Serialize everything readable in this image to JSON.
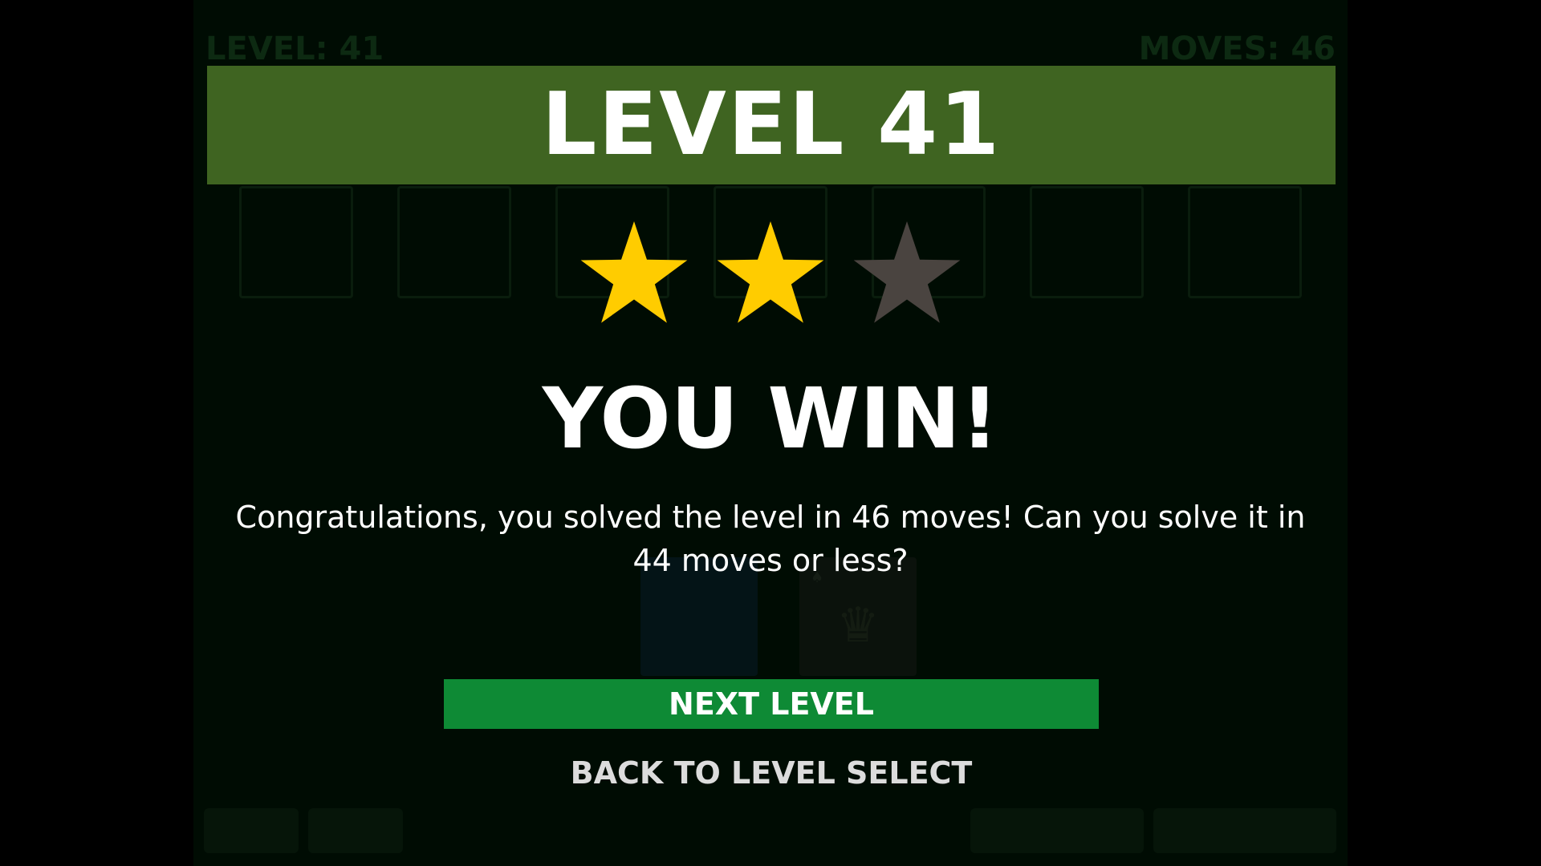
{
  "background": {
    "level_label": "LEVEL: 41",
    "moves_label": "MOVES: 46"
  },
  "dialog": {
    "title": "LEVEL 41",
    "heading": "YOU WIN!",
    "message": "Congratulations, you solved the level in 46 moves!  Can you solve it in 44 moves or less?",
    "rating": {
      "earned": 2,
      "total": 3
    },
    "next_label": "NEXT LEVEL",
    "back_label": "BACK TO LEVEL SELECT"
  },
  "colors": {
    "title_bar": "#3f6421",
    "star_earned": "#ffcc00",
    "star_empty": "#4a4440",
    "next_button": "#0e8a35",
    "background": "#000c03"
  },
  "icons": {
    "rating_star": "star-icon",
    "card_crown": "crown-icon"
  }
}
